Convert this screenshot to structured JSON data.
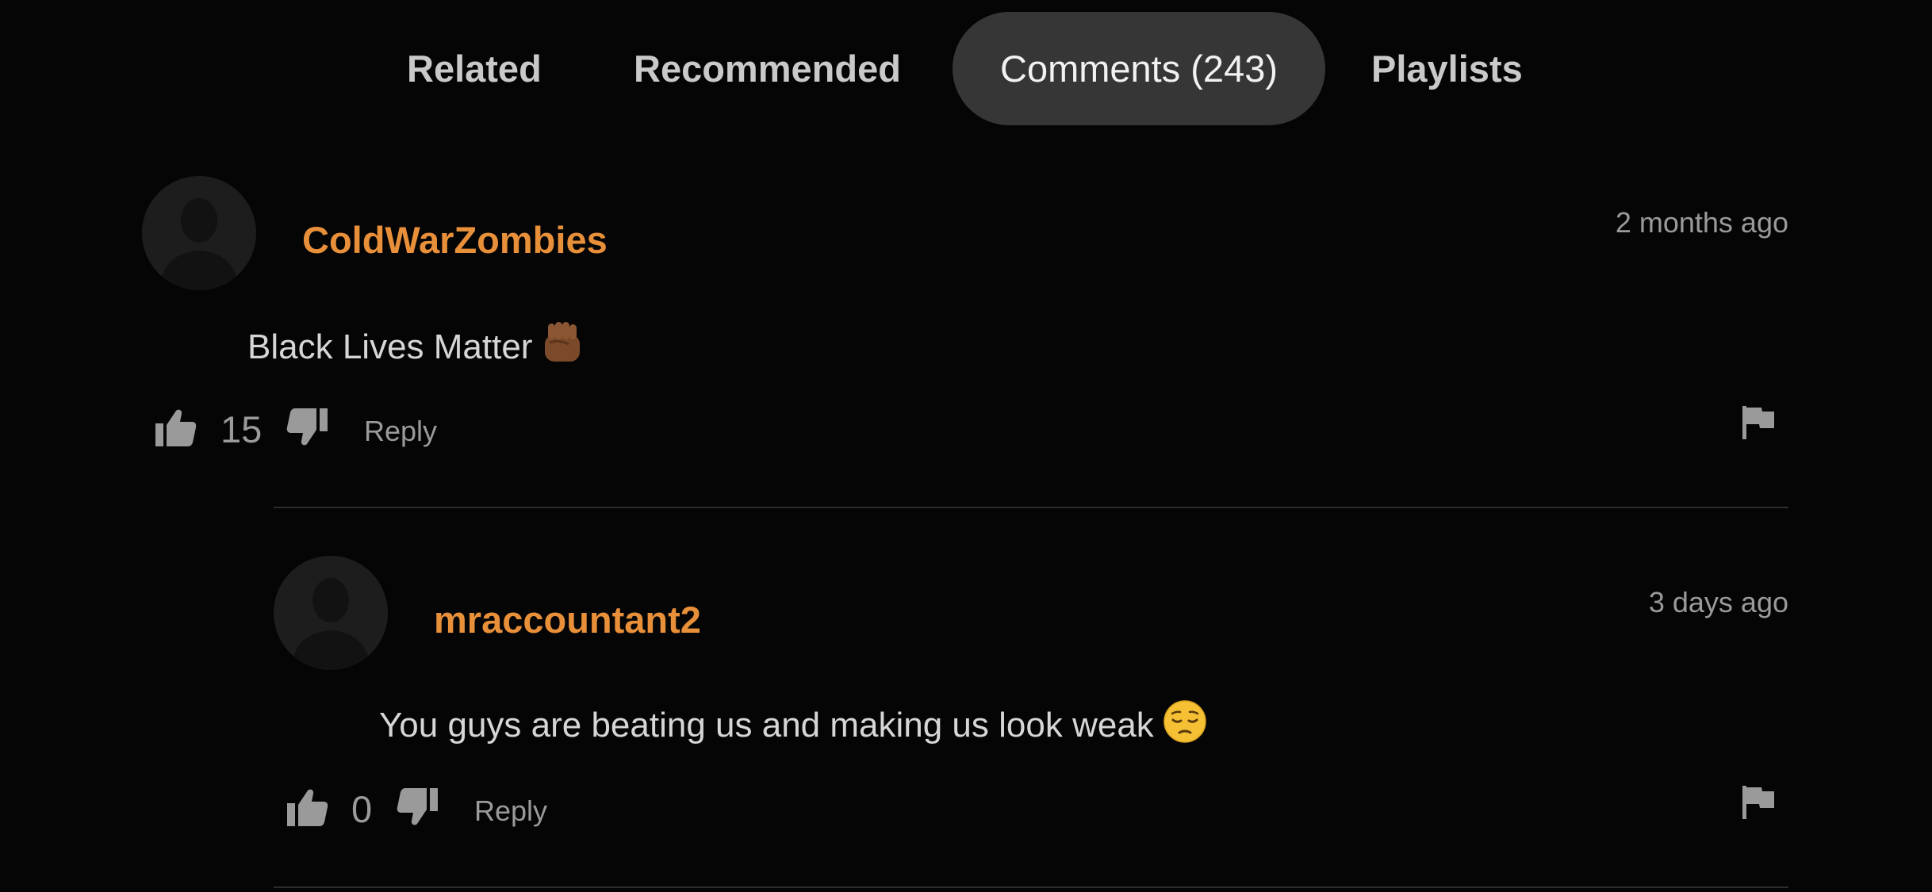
{
  "tabs": [
    {
      "label": "Related"
    },
    {
      "label": "Recommended"
    },
    {
      "label": "Comments (243)"
    },
    {
      "label": "Playlists"
    }
  ],
  "active_tab": "Comments (243)",
  "comments": [
    {
      "username": "ColdWarZombies",
      "timestamp": "2 months ago",
      "text": "Black Lives Matter",
      "emoji": "raised-fist-emoji",
      "likes": "15",
      "reply_label": "Reply"
    },
    {
      "username": "mraccountant2",
      "timestamp": "3 days ago",
      "text": "You guys are beating us and making us look weak",
      "emoji": "pensive-face-emoji",
      "likes": "0",
      "reply_label": "Reply"
    }
  ],
  "colors": {
    "background": "#050505",
    "username": "#e88f3a",
    "active_tab_bg": "#363636",
    "muted_text": "#9a9a9a"
  }
}
